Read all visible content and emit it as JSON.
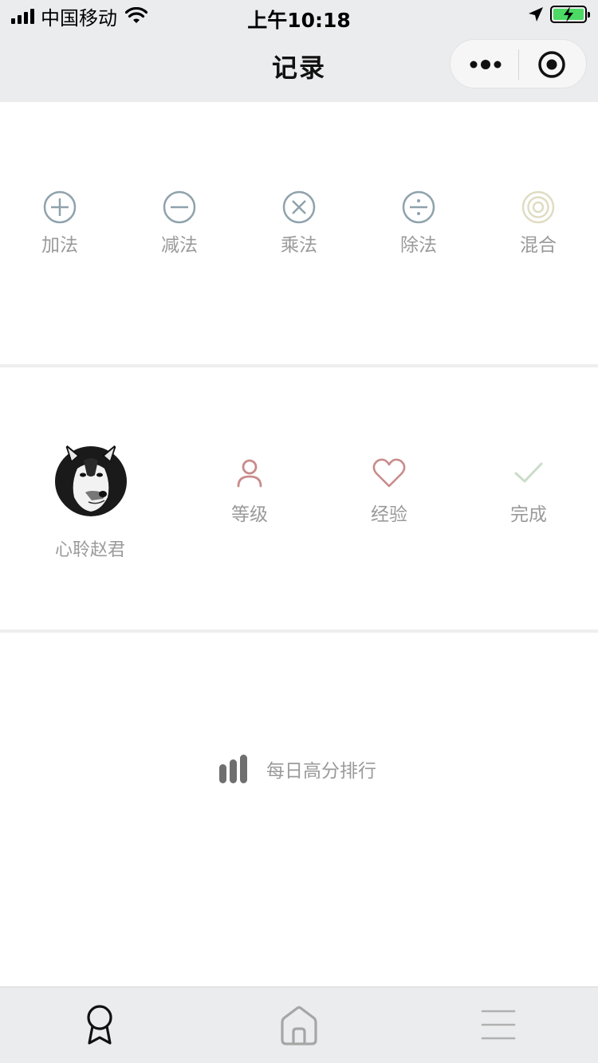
{
  "status_bar": {
    "carrier": "中国移动",
    "time": "上午10:18"
  },
  "nav": {
    "title": "记录"
  },
  "operations": [
    {
      "label": "加法",
      "icon": "plus-circle-icon"
    },
    {
      "label": "减法",
      "icon": "minus-circle-icon"
    },
    {
      "label": "乘法",
      "icon": "times-circle-icon"
    },
    {
      "label": "除法",
      "icon": "divide-circle-icon"
    },
    {
      "label": "混合",
      "icon": "concentric-circles-icon"
    }
  ],
  "user": {
    "name": "心聆赵君",
    "stats": [
      {
        "label": "等级",
        "icon": "person-icon"
      },
      {
        "label": "经验",
        "icon": "heart-icon"
      },
      {
        "label": "完成",
        "icon": "check-icon"
      }
    ]
  },
  "rank": {
    "label": "每日高分排行",
    "icon": "bar-chart-icon"
  },
  "tabbar": [
    {
      "icon": "award-ribbon-icon",
      "active": true
    },
    {
      "icon": "home-icon",
      "active": false
    },
    {
      "icon": "menu-lines-icon",
      "active": false
    }
  ],
  "colors": {
    "nav_bg": "#ebecee",
    "label_gray": "#9a9a9a",
    "op_icon": "#8fa2ac",
    "mixed_icon": "#e0dcc4",
    "stat_red": "#c98b8b",
    "check_green": "#c9ddc9"
  }
}
